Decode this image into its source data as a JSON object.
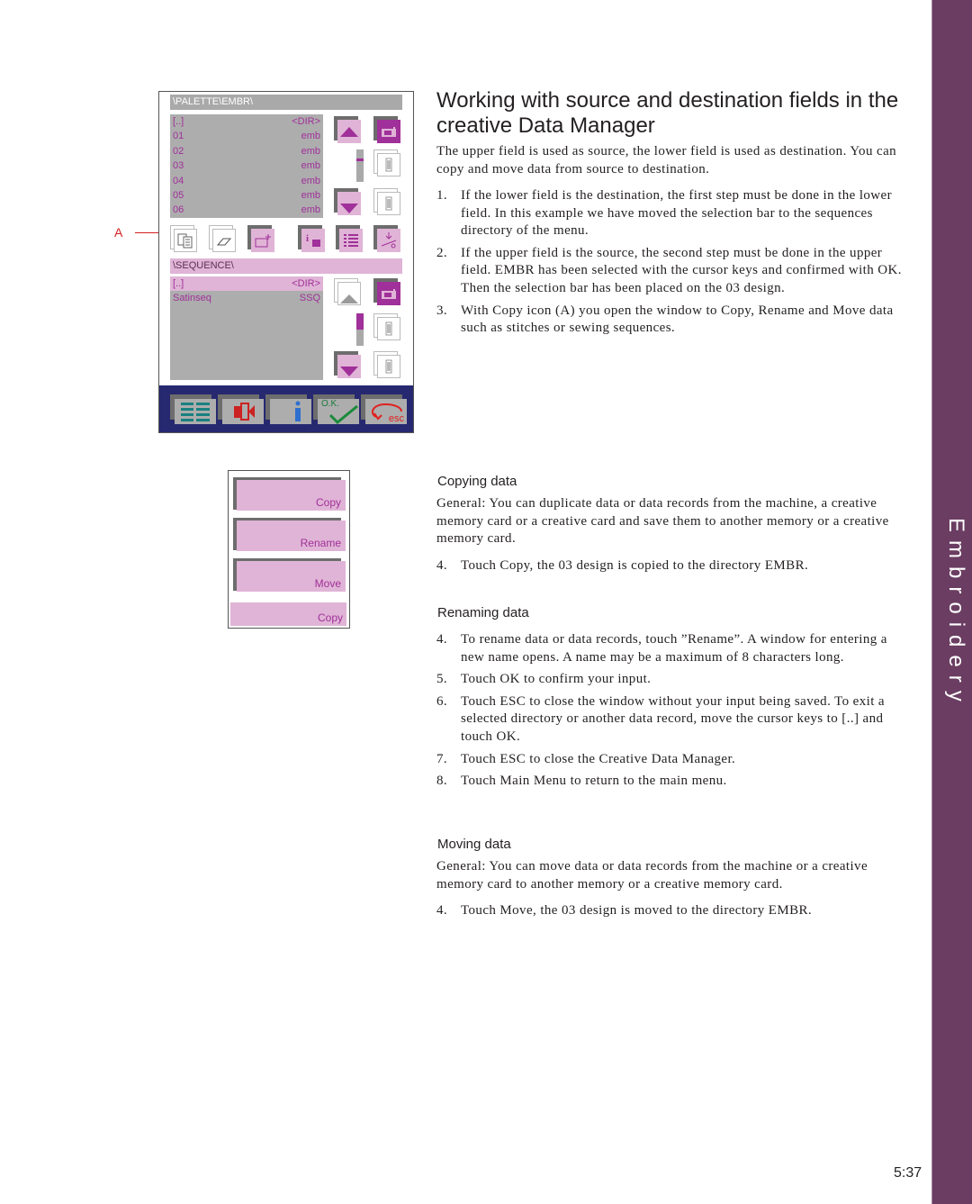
{
  "side_tab": {
    "label": "Embroidery",
    "color": "#6b3d62"
  },
  "page_number": "5:37",
  "device_screen": {
    "top_path": "\\PALETTE\\EMBR\\",
    "top_list": [
      {
        "name": "[..]",
        "type": "<DIR>"
      },
      {
        "name": "01",
        "type": "emb"
      },
      {
        "name": "02",
        "type": "emb"
      },
      {
        "name": "03",
        "type": "emb"
      },
      {
        "name": "04",
        "type": "emb"
      },
      {
        "name": "05",
        "type": "emb"
      },
      {
        "name": "06",
        "type": "emb"
      }
    ],
    "bottom_path": "\\SEQUENCE\\",
    "bottom_list": [
      {
        "name": "[..]",
        "type": "<DIR>"
      },
      {
        "name": "Satinseq",
        "type": "SSQ"
      }
    ],
    "ok_label": "O.K.",
    "esc_label": "esc",
    "annotation": "A",
    "colors": {
      "accent": "#a0309a",
      "highlight": "#e0b4d6",
      "list_bg": "#adadad",
      "bottom_bar": "#262870"
    }
  },
  "popup": {
    "buttons": [
      "Copy",
      "Rename",
      "Move"
    ],
    "footer_label": "Copy"
  },
  "content": {
    "heading": "Working with source and destination fields in the creative Data Manager",
    "intro": "The upper field is used as source, the lower field is used as destination. You can copy and move data from source to destination.",
    "steps": [
      {
        "num": "1.",
        "text": "If the lower field is the destination, the first step must be done in the lower field. In this example we have moved the selection bar to the sequences directory of the menu."
      },
      {
        "num": "2.",
        "text": "If the upper field is the source, the second step must be done in the upper field. EMBR has been selected with the cursor keys and confirmed with OK. Then the selection bar has been placed on the 03 design."
      },
      {
        "num": "3.",
        "text": "With Copy icon (A) you open the window to Copy, Rename and Move data such as stitches or sewing sequences."
      }
    ],
    "copying": {
      "title": "Copying data",
      "general": "General: You can duplicate data or data records from the machine, a creative memory card or a creative card and save them to another memory or a creative memory card.",
      "steps": [
        {
          "num": "4.",
          "text": "Touch Copy, the 03 design is copied to the directory EMBR."
        }
      ]
    },
    "renaming": {
      "title": "Renaming data",
      "steps": [
        {
          "num": "4.",
          "text": "To rename data or data records, touch ”Rename”. A window for entering a new name opens. A name may be a maximum of 8 characters long."
        },
        {
          "num": "5.",
          "text": "Touch OK to confirm your input."
        },
        {
          "num": "6.",
          "text": "Touch ESC to close the window without your input being saved. To exit a selected directory or another data record, move the cursor keys to [..] and touch OK."
        },
        {
          "num": "7.",
          "text": "Touch ESC to close the Creative Data Manager."
        },
        {
          "num": "8.",
          "text": "Touch Main Menu to return to the main menu."
        }
      ]
    },
    "moving": {
      "title": "Moving data",
      "general": "General: You can move data or data records from the machine or a creative memory card to another memory or a creative memory card.",
      "steps": [
        {
          "num": "4.",
          "text": "Touch Move, the 03 design is moved to the directory EMBR."
        }
      ]
    }
  }
}
